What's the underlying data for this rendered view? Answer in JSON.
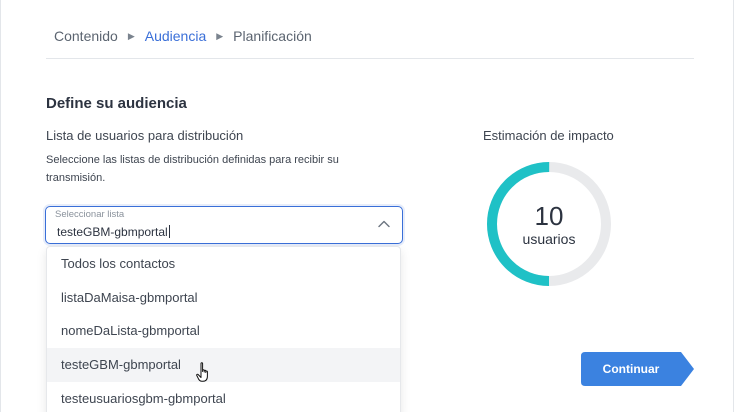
{
  "breadcrumb": {
    "steps": [
      {
        "label": "Contenido"
      },
      {
        "label": "Audiencia"
      },
      {
        "label": "Planificación"
      }
    ],
    "separator": "▶",
    "active_index": 1
  },
  "section": {
    "title": "Define su audiencia"
  },
  "distribution": {
    "title": "Lista de usuarios para distribución",
    "description": "Seleccione las listas de distribución definidas para recibir su transmisión.",
    "select": {
      "label": "Seleccionar lista",
      "value": "testeGBM-gbmportal",
      "icon": "chevron-up-icon"
    },
    "options": [
      {
        "label": "Todos los contactos"
      },
      {
        "label": "listaDaMaisa-gbmportal"
      },
      {
        "label": "nomeDaLista-gbmportal"
      },
      {
        "label": "testeGBM-gbmportal"
      },
      {
        "label": "testeusuariosgbm-gbmportal"
      }
    ],
    "hovered_option_index": 3
  },
  "impact": {
    "title": "Estimación de impacto",
    "count": "10",
    "unit": "usuarios",
    "fill_fraction": 0.5
  },
  "actions": {
    "continue_label": "Continuar"
  },
  "colors": {
    "accent": "#3a6fd8",
    "button": "#3b82e0",
    "gauge_fill": "#1fc1c6",
    "gauge_track": "#e9eaec"
  }
}
